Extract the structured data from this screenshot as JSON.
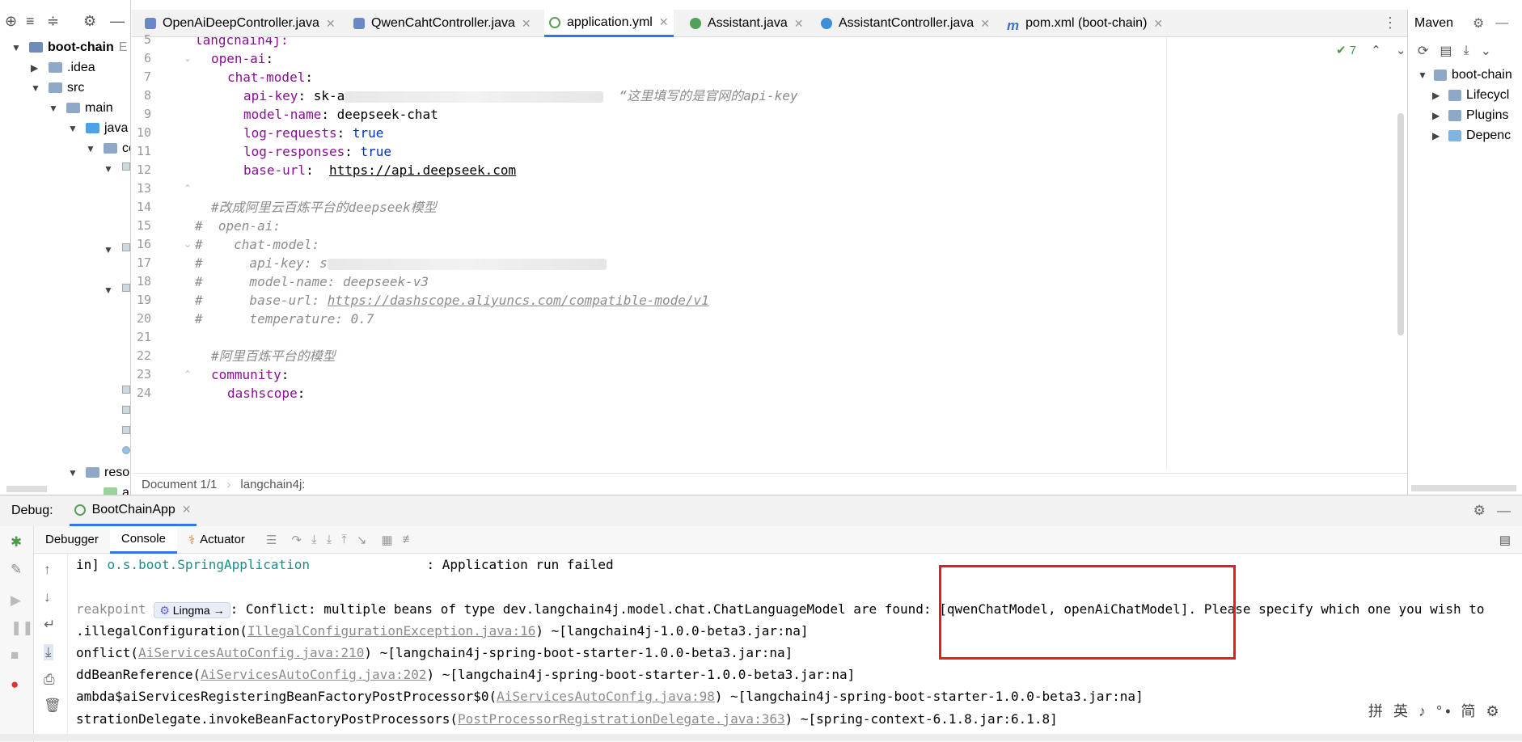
{
  "project": {
    "items": [
      {
        "label": "boot-chain",
        "suffix": "E"
      },
      {
        "label": ".idea"
      },
      {
        "label": "src"
      },
      {
        "label": "main"
      },
      {
        "label": "java"
      },
      {
        "label": "co"
      },
      {
        "label": "reso"
      },
      {
        "label": "a"
      }
    ]
  },
  "tabs": [
    {
      "label": "OpenAiDeepController.java"
    },
    {
      "label": "QwenCahtController.java"
    },
    {
      "label": "application.yml"
    },
    {
      "label": "Assistant.java"
    },
    {
      "label": "AssistantController.java"
    },
    {
      "label": "pom.xml (boot-chain)"
    }
  ],
  "editor": {
    "line_numbers": [
      "5",
      "6",
      "7",
      "8",
      "9",
      "10",
      "11",
      "12",
      "13",
      "14",
      "15",
      "16",
      "17",
      "18",
      "19",
      "20",
      "21",
      "22",
      "23",
      "24"
    ],
    "lines": {
      "l5": "langchain4j:",
      "l6_key": "open-ai",
      "l7_key": "chat-model",
      "l8_key": "api-key",
      "l8_val": "sk-a",
      "l8_comment": "“这里填写的是官网的api-key",
      "l9_key": "model-name",
      "l9_val": "deepseek-chat",
      "l10_key": "log-requests",
      "l10_val": "true",
      "l11_key": "log-responses",
      "l11_val": "true",
      "l12_key": "base-url",
      "l12_val": "https://api.deepseek.com",
      "l14": "#改成阿里云百炼平台的deepseek模型",
      "l15": "#  open-ai:",
      "l16": "#    chat-model:",
      "l17": "#      api-key: s",
      "l18": "#      model-name: deepseek-v3",
      "l19_pre": "#      base-url: ",
      "l19_url": "https://dashscope.aliyuncs.com/compatible-mode/v1",
      "l20": "#      temperature: 0.7",
      "l22": "#阿里百炼平台的模型",
      "l23_key": "community",
      "l24_key": "dashscope"
    },
    "inspection_count": "7",
    "breadcrumb": [
      "Document 1/1",
      "langchain4j:"
    ]
  },
  "maven": {
    "title": "Maven",
    "items": [
      {
        "label": "boot-chain"
      },
      {
        "label": "Lifecycl"
      },
      {
        "label": "Plugins"
      },
      {
        "label": "Depenc"
      }
    ]
  },
  "debug": {
    "title": "Debug:",
    "run_config": "BootChainApp",
    "tabs": [
      "Debugger",
      "Console",
      "Actuator"
    ],
    "console": {
      "l1_pre": "in] ",
      "l1_cls": "o.s.boot.SpringApplication",
      "l1_msg": "               : Application run failed",
      "l2_pre": "reakpoint",
      "l2_badge": "Lingma →",
      "l2_msg": ": Conflict: multiple beans of type dev.langchain4j.model.chat.ChatLanguageModel are found: [qwenChatModel, openAiChatModel]. Please specify which one you wish to",
      "l3_pre": ".illegalConfiguration(",
      "l3_link": "IllegalConfigurationException.java:16",
      "l3_post": ") ~[langchain4j-1.0.0-beta3.jar:na]",
      "l4_pre": "onflict(",
      "l4_link": "AiServicesAutoConfig.java:210",
      "l4_post": ") ~[langchain4j-spring-boot-starter-1.0.0-beta3.jar:na]",
      "l5_pre": "ddBeanReference(",
      "l5_link": "AiServicesAutoConfig.java:202",
      "l5_post": ") ~[langchain4j-spring-boot-starter-1.0.0-beta3.jar:na]",
      "l6_pre": "ambda$aiServicesRegisteringBeanFactoryPostProcessor$0(",
      "l6_link": "AiServicesAutoConfig.java:98",
      "l6_post": ") ~[langchain4j-spring-boot-starter-1.0.0-beta3.jar:na]",
      "l7_pre": "strationDelegate.invokeBeanFactoryPostProcessors(",
      "l7_link": "PostProcessorRegistrationDelegate.java:363",
      "l7_post": ") ~[spring-context-6.1.8.jar:6.1.8]"
    }
  },
  "ime": "拼 英 ♪ °• 简 ⚙",
  "colors": {
    "accent": "#3574f0",
    "highlight_box": "#e02020",
    "yaml_key": "#871094",
    "comment": "#8c8c8c"
  }
}
